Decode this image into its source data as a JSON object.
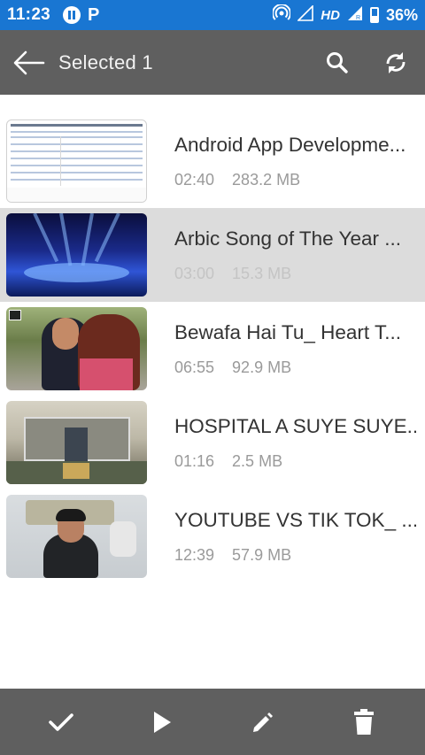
{
  "status_bar": {
    "time": "11:23",
    "network_label": "HD",
    "battery": "36%",
    "icons": [
      "pause-circle-icon",
      "p-app-icon",
      "hotspot-icon",
      "signal-icon",
      "signal-roaming-icon",
      "battery-icon"
    ]
  },
  "app_bar": {
    "title": "Selected 1",
    "icons": [
      "back-arrow-icon",
      "search-icon",
      "sync-icon"
    ]
  },
  "videos": [
    {
      "title": "Android App Developme...",
      "duration": "02:40",
      "size": "283.2 MB",
      "selected": false
    },
    {
      "title": "Arbic Song of The Year ...",
      "duration": "03:00",
      "size": "15.3 MB",
      "selected": true
    },
    {
      "title": "Bewafa Hai Tu_ Heart T...",
      "duration": "06:55",
      "size": "92.9 MB",
      "selected": false
    },
    {
      "title": "HOSPITAL A SUYE SUYE...",
      "duration": "01:16",
      "size": "2.5 MB",
      "selected": false
    },
    {
      "title": "YOUTUBE VS TIK TOK_ ...",
      "duration": "12:39",
      "size": "57.9 MB",
      "selected": false
    }
  ],
  "bottom_bar": {
    "icons": [
      "check-icon",
      "play-icon",
      "edit-icon",
      "delete-icon"
    ]
  },
  "colors": {
    "status_bar": "#1976d2",
    "toolbar": "#5f5f5f",
    "selected_row": "#dcdcdc"
  }
}
